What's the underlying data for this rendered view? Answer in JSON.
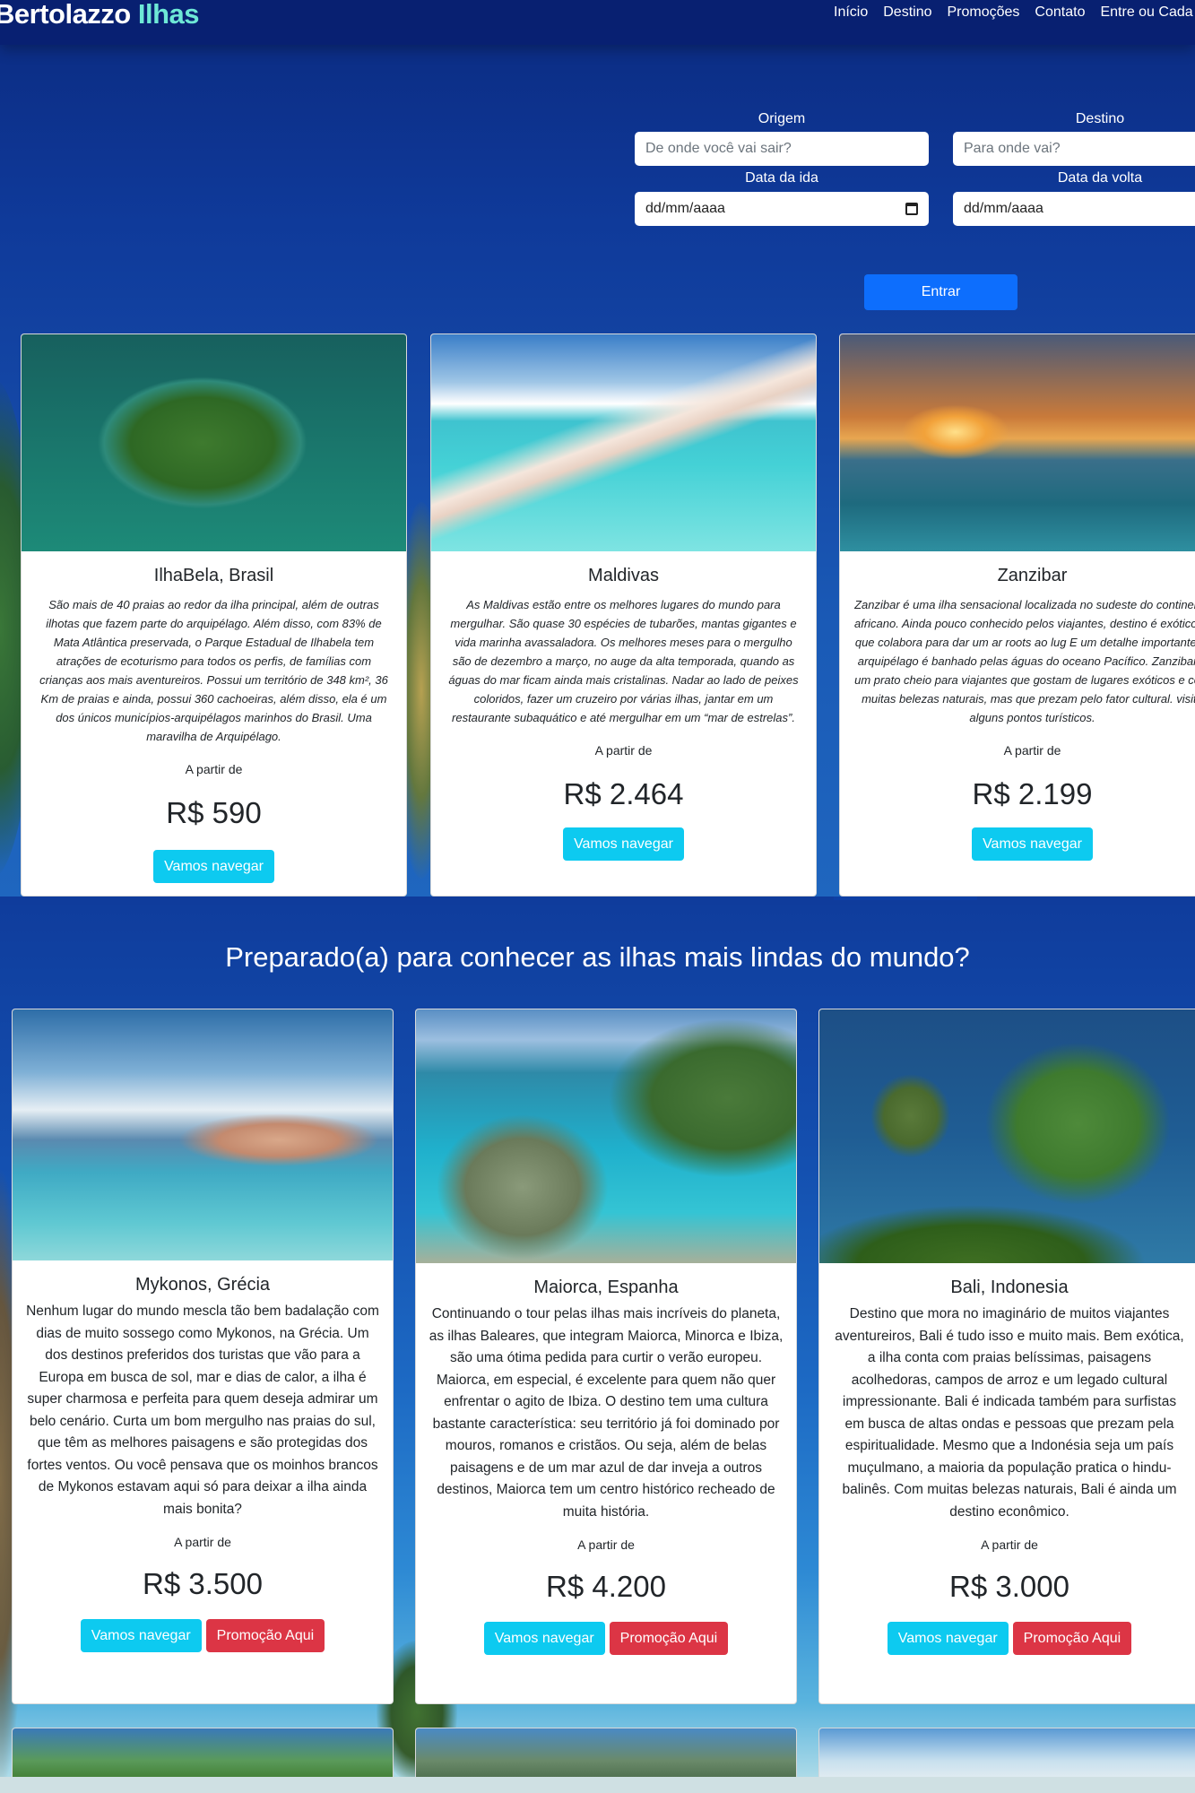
{
  "brand": {
    "name": "Bertolazzo",
    "accent": "Ilhas"
  },
  "nav": {
    "items": [
      "Início",
      "Destino",
      "Promoções",
      "Contato",
      "Entre ou Cada"
    ]
  },
  "search": {
    "origem_label": "Origem",
    "origem_placeholder": "De onde você vai sair?",
    "destino_label": "Destino",
    "destino_placeholder": "Para onde vai?",
    "ida_label": "Data da ida",
    "ida_value": "dd/mm/aaaa",
    "volta_label": "Data da volta",
    "volta_value": "dd/mm/aaaa",
    "submit_label": "Entrar"
  },
  "featured": [
    {
      "title": "IlhaBela, Brasil",
      "description": "São mais de 40 praias ao redor da ilha principal, além de outras ilhotas que fazem parte do arquipélago. Além disso, com 83% de Mata Atlântica preservada, o Parque Estadual de Ilhabela tem atrações de ecoturismo para todos os perfis, de famílias com crianças aos mais aventureiros. Possui um território de 348 km², 36 Km de praias e ainda, possui 360 cachoeiras, além disso, ela é um dos únicos municípios-arquipélagos marinhos do Brasil. Uma maravilha de Arquipélago.",
      "from_label": "A partir de",
      "price": "R$ 590",
      "button": "Vamos navegar"
    },
    {
      "title": "Maldivas",
      "description": "As Maldivas estão entre os melhores lugares do mundo para mergulhar. São quase 30 espécies de tubarões, mantas gigantes e vida marinha avassaladora. Os melhores meses para o mergulho são de dezembro a março, no auge da alta temporada, quando as águas do mar ficam ainda mais cristalinas. Nadar ao lado de peixes coloridos, fazer um cruzeiro por várias ilhas, jantar em um restaurante subaquático e até mergulhar em um “mar de estrelas”.",
      "from_label": "A partir de",
      "price": "R$ 2.464",
      "button": "Vamos navegar"
    },
    {
      "title": "Zanzibar",
      "description": "Zanzibar é uma ilha sensacional localizada no sudeste do continente africano. Ainda pouco conhecido pelos viajantes, destino é exótico, o que colabora para dar um ar roots ao lug E um detalhe importante: o arquipélago é banhado pelas águas do oceano Pacífico. Zanzibar é um prato cheio para viajantes que gostam de lugares exóticos e com muitas belezas naturais, mas que prezam pelo fator cultural. visite alguns pontos turísticos.",
      "from_label": "A partir de",
      "price": "R$ 2.199",
      "button": "Vamos navegar"
    }
  ],
  "section_title": "Preparado(a) para conhecer as ilhas mais lindas do mundo?",
  "destinations": [
    {
      "title": "Mykonos, Grécia",
      "description": "Nenhum lugar do mundo mescla tão bem badalação com dias de muito sossego como Mykonos, na Grécia. Um dos destinos preferidos dos turistas que vão para a Europa em busca de sol, mar e dias de calor, a ilha é super charmosa e perfeita para quem deseja admirar um belo cenário. Curta um bom mergulho nas praias do sul, que têm as melhores paisagens e são protegidas dos fortes ventos. Ou você pensava que os moinhos brancos de Mykonos estavam aqui só para deixar a ilha ainda mais bonita?",
      "from_label": "A partir de",
      "price": "R$ 3.500",
      "button_primary": "Vamos navegar",
      "button_promo": "Promoção Aqui"
    },
    {
      "title": "Maiorca, Espanha",
      "description": "Continuando o tour pelas ilhas mais incríveis do planeta, as ilhas Baleares, que integram Maiorca, Minorca e Ibiza, são uma ótima pedida para curtir o verão europeu. Maiorca, em especial, é excelente para quem não quer enfrentar o agito de Ibiza. O destino tem uma cultura bastante característica: seu território já foi dominado por mouros, romanos e cristãos. Ou seja, além de belas paisagens e de um mar azul de dar inveja a outros destinos, Maiorca tem um centro histórico recheado de muita história.",
      "from_label": "A partir de",
      "price": "R$ 4.200",
      "button_primary": "Vamos navegar",
      "button_promo": "Promoção Aqui"
    },
    {
      "title": "Bali, Indonesia",
      "description": "Destino que mora no imaginário de muitos viajantes aventureiros, Bali é tudo isso e muito mais. Bem exótica, a ilha conta com praias belíssimas, paisagens acolhedoras, campos de arroz e um legado cultural impressionante. Bali é indicada também para surfistas em busca de altas ondas e pessoas que prezam pela espiritualidade. Mesmo que a Indonésia seja um país muçulmano, a maioria da população pratica o hindu-balinês. Com muitas belezas naturais, Bali é ainda um destino econômico.",
      "from_label": "A partir de",
      "price": "R$ 3.000",
      "button_primary": "Vamos navegar",
      "button_promo": "Promoção Aqui"
    }
  ],
  "colors": {
    "primary": "#0d6efd",
    "info": "#0dcaf0",
    "danger": "#dc3545",
    "accent": "#6ee8d6"
  }
}
